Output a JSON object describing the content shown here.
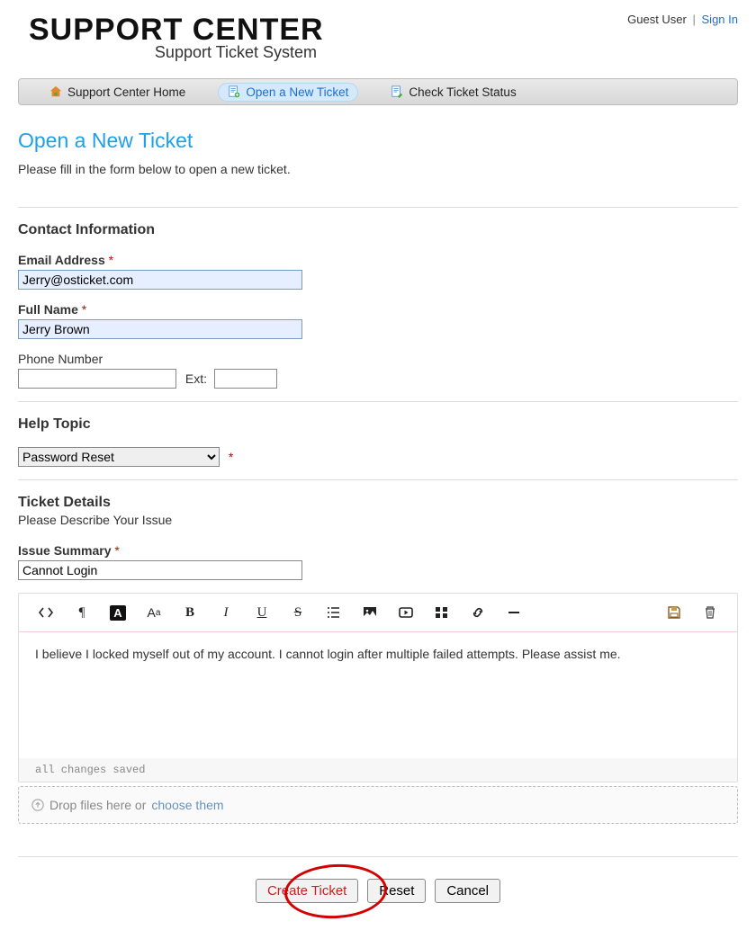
{
  "header": {
    "guest_label": "Guest User",
    "signin_label": "Sign In",
    "logo_main": "SUPPORT CENTER",
    "logo_sub": "Support Ticket System"
  },
  "nav": {
    "home": "Support Center Home",
    "new_ticket": "Open a New Ticket",
    "check_status": "Check Ticket Status"
  },
  "page": {
    "title": "Open a New Ticket",
    "intro": "Please fill in the form below to open a new ticket."
  },
  "contact": {
    "heading": "Contact Information",
    "email_label": "Email Address",
    "email_value": "Jerry@osticket.com",
    "name_label": "Full Name",
    "name_value": "Jerry Brown",
    "phone_label": "Phone Number",
    "phone_value": "",
    "ext_label": "Ext:",
    "ext_value": ""
  },
  "help_topic": {
    "heading": "Help Topic",
    "selected": "Password Reset"
  },
  "ticket": {
    "heading": "Ticket Details",
    "subtext": "Please Describe Your Issue",
    "summary_label": "Issue Summary",
    "summary_value": "Cannot Login",
    "body_text": "I believe I locked myself out of my account. I cannot login after multiple failed attempts. Please assist me.",
    "status_text": "all changes saved"
  },
  "dropzone": {
    "text": "Drop files here or ",
    "choose": "choose them"
  },
  "buttons": {
    "create": "Create Ticket",
    "reset": "Reset",
    "cancel": "Cancel"
  },
  "required_marker": "*"
}
